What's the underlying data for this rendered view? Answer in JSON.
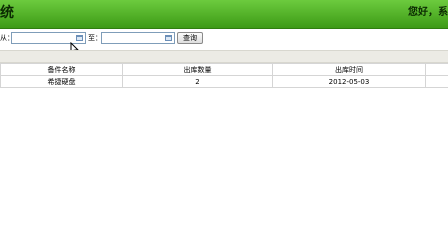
{
  "header": {
    "title": "统",
    "greeting": "您好，系"
  },
  "toolbar": {
    "from_label": "从：",
    "from_value": "",
    "to_label": "至：",
    "to_value": "",
    "query_label": "查询"
  },
  "table": {
    "columns": [
      "备件名称",
      "出库数量",
      "出库时间"
    ],
    "rows": [
      {
        "name": "希捷硬盘",
        "qty": "2",
        "date": "2012-05-03"
      }
    ]
  }
}
